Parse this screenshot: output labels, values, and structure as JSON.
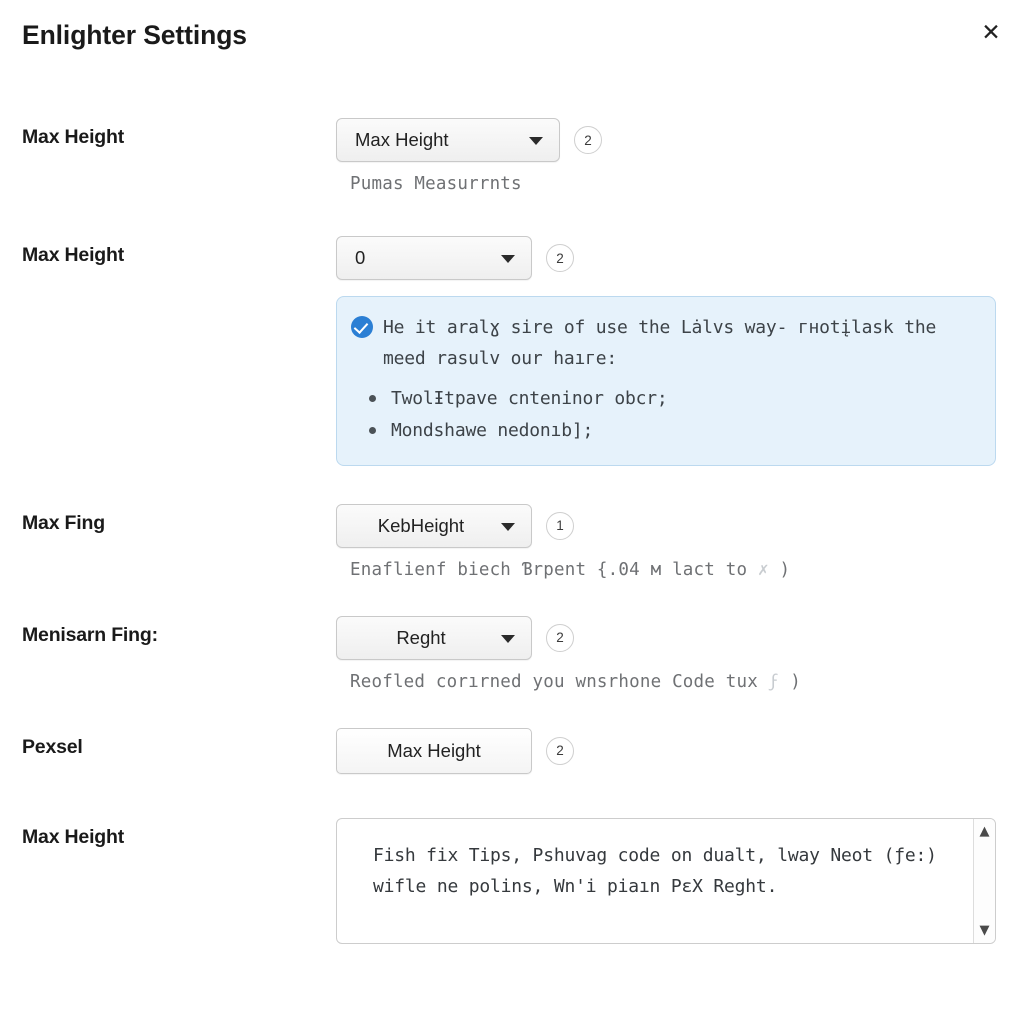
{
  "header": {
    "title": "Enlighter Settings",
    "close_label": "✕"
  },
  "rows": {
    "max_height_1": {
      "label": "Max Height",
      "select_value": "Max Height",
      "badge": "2",
      "helper": "Pumas Measurrnts"
    },
    "max_height_2": {
      "label": "Max Height",
      "select_value": "0",
      "badge": "2"
    },
    "max_fing": {
      "label": "Max Fing",
      "select_value": "KebHeight",
      "badge": "1",
      "helper_before": "Enaflienf biech Ɓrpent {.04 м lact to ",
      "helper_glyph": "✗",
      "helper_after": " )"
    },
    "menisarn_fing": {
      "label": "Menisarn Fing:",
      "select_value": "Reght",
      "badge": "2",
      "helper_before": "Reofled corırned you wnѕrhone Code tux ",
      "helper_glyph": "ϝ",
      "helper_after": " )"
    },
    "pexsel": {
      "label": "Pexsel",
      "button_value": "Max Height",
      "badge": "2"
    },
    "max_height_3": {
      "label": "Max Height",
      "textarea_value": "Fish fix Tips, Pshuvаg code on dualt, lway Neot (ƒe:)\nwifle ne polins, Wn'i piaın PεX Reght."
    }
  },
  "info_box": {
    "icon": "check-circle-icon",
    "text": "He it aralɣ sire of use the Lȧlvs way- гнotįlask the meed rasulv our haıгe:",
    "bullets": [
      "TwolƗtpave cntеninor obcr;",
      "Mondshawe nedonıb];"
    ]
  },
  "colors": {
    "accent_blue": "#2b7fd4",
    "info_bg": "#e6f2fb",
    "info_border": "#bcd9ef",
    "text_primary": "#1a1a1a",
    "text_muted": "#6f7174"
  }
}
